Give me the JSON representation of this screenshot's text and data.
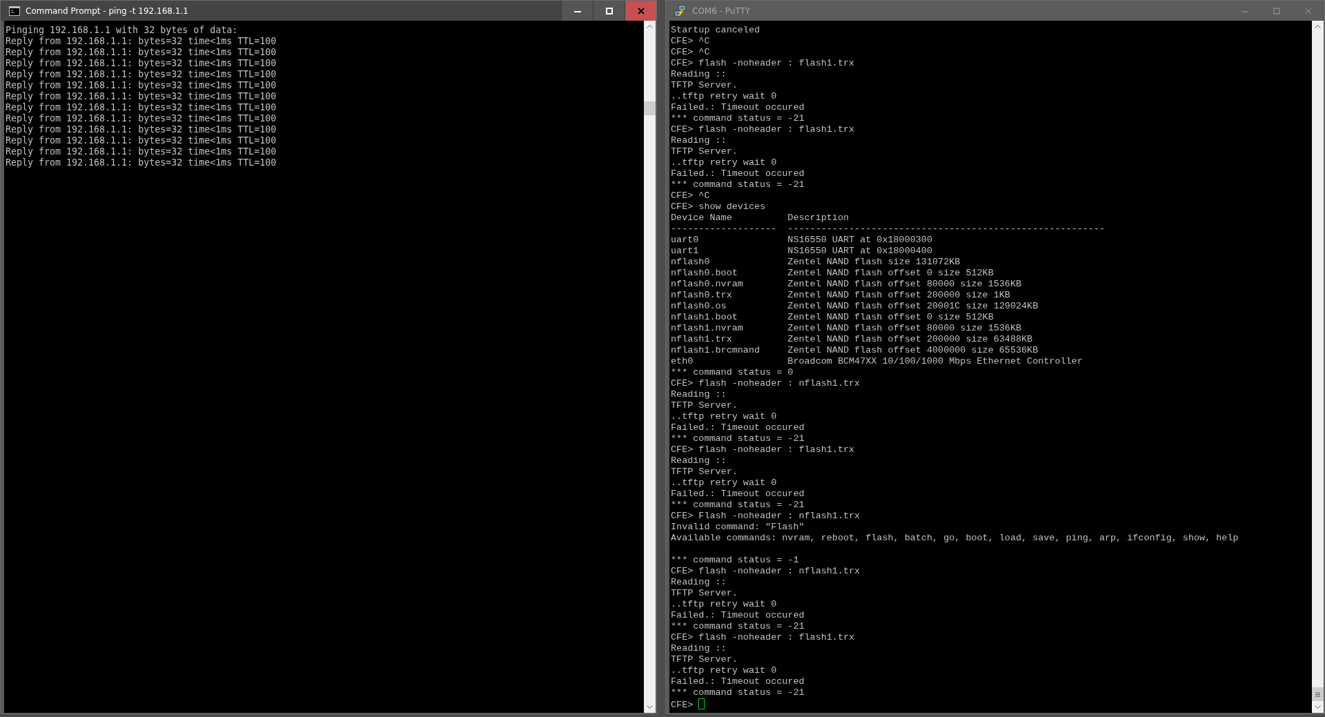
{
  "windows": [
    {
      "kind": "cmd",
      "title": "Command Prompt - ping  -t 192.168.1.1",
      "active": true,
      "cursor": false,
      "lines": [
        "Pinging 192.168.1.1 with 32 bytes of data:",
        "Reply from 192.168.1.1: bytes=32 time<1ms TTL=100",
        "Reply from 192.168.1.1: bytes=32 time<1ms TTL=100",
        "Reply from 192.168.1.1: bytes=32 time<1ms TTL=100",
        "Reply from 192.168.1.1: bytes=32 time<1ms TTL=100",
        "Reply from 192.168.1.1: bytes=32 time<1ms TTL=100",
        "Reply from 192.168.1.1: bytes=32 time<1ms TTL=100",
        "Reply from 192.168.1.1: bytes=32 time<1ms TTL=100",
        "Reply from 192.168.1.1: bytes=32 time<1ms TTL=100",
        "Reply from 192.168.1.1: bytes=32 time<1ms TTL=100",
        "Reply from 192.168.1.1: bytes=32 time<1ms TTL=100",
        "Reply from 192.168.1.1: bytes=32 time<1ms TTL=100",
        "Reply from 192.168.1.1: bytes=32 time<1ms TTL=100"
      ]
    },
    {
      "kind": "putty",
      "title": "COM6 - PuTTY",
      "active": false,
      "cursor": true,
      "lines": [
        "Startup canceled",
        "CFE> ^C",
        "CFE> ^C",
        "CFE> flash -noheader : flash1.trx",
        "Reading ::",
        "TFTP Server.",
        "..tftp retry wait 0",
        "Failed.: Timeout occured",
        "*** command status = -21",
        "CFE> flash -noheader : flash1.trx",
        "Reading ::",
        "TFTP Server.",
        "..tftp retry wait 0",
        "Failed.: Timeout occured",
        "*** command status = -21",
        "CFE> ^C",
        "CFE> show devices",
        "Device Name          Description",
        "-------------------  ---------------------------------------------------------",
        "uart0                NS16550 UART at 0x18000300",
        "uart1                NS16550 UART at 0x18000400",
        "nflash0              Zentel NAND flash size 131072KB",
        "nflash0.boot         Zentel NAND flash offset 0 size 512KB",
        "nflash0.nvram        Zentel NAND flash offset 80000 size 1536KB",
        "nflash0.trx          Zentel NAND flash offset 200000 size 1KB",
        "nflash0.os           Zentel NAND flash offset 20001C size 129024KB",
        "nflash1.boot         Zentel NAND flash offset 0 size 512KB",
        "nflash1.nvram        Zentel NAND flash offset 80000 size 1536KB",
        "nflash1.trx          Zentel NAND flash offset 200000 size 63488KB",
        "nflash1.brcmnand     Zentel NAND flash offset 4000000 size 65536KB",
        "eth0                 Broadcom BCM47XX 10/100/1000 Mbps Ethernet Controller",
        "*** command status = 0",
        "CFE> flash -noheader : nflash1.trx",
        "Reading ::",
        "TFTP Server.",
        "..tftp retry wait 0",
        "Failed.: Timeout occured",
        "*** command status = -21",
        "CFE> flash -noheader : flash1.trx",
        "Reading ::",
        "TFTP Server.",
        "..tftp retry wait 0",
        "Failed.: Timeout occured",
        "*** command status = -21",
        "CFE> Flash -noheader : nflash1.trx",
        "Invalid command: \"Flash\"",
        "Available commands: nvram, reboot, flash, batch, go, boot, load, save, ping, arp, ifconfig, show, help",
        {
          "text": "*** command status = -1",
          "gap_before": true
        },
        "CFE> flash -noheader : nflash1.trx",
        "Reading ::",
        "TFTP Server.",
        "..tftp retry wait 0",
        "Failed.: Timeout occured",
        "*** command status = -21",
        "CFE> flash -noheader : flash1.trx",
        "Reading ::",
        "TFTP Server.",
        "..tftp retry wait 0",
        "Failed.: Timeout occured",
        "*** command status = -21",
        "CFE>"
      ]
    }
  ]
}
